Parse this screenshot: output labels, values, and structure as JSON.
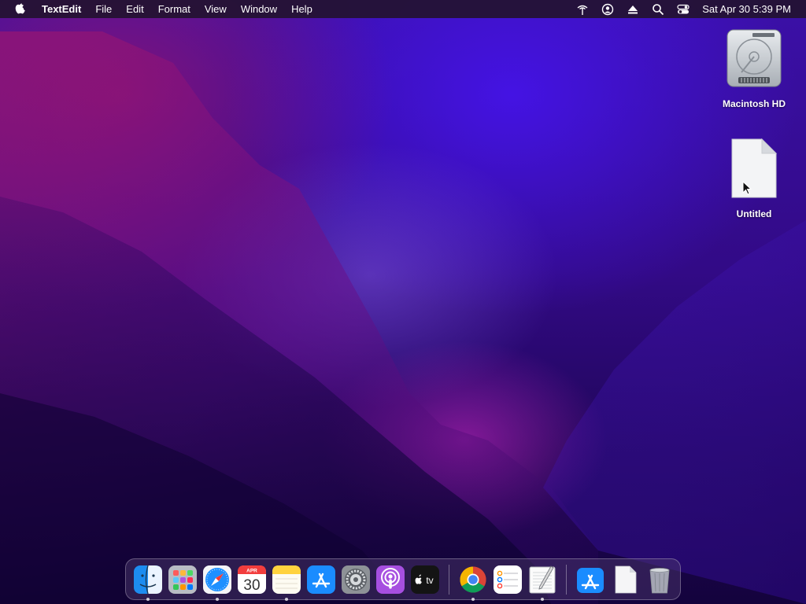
{
  "menubar": {
    "app_name": "TextEdit",
    "menus": [
      "File",
      "Edit",
      "Format",
      "View",
      "Window",
      "Help"
    ],
    "clock": "Sat Apr 30  5:39 PM",
    "status_icons": [
      "airdrop-icon",
      "user-account-icon",
      "eject-icon",
      "search-icon",
      "control-center-icon"
    ]
  },
  "desktop": {
    "icons": [
      {
        "label": "Macintosh HD",
        "icon": "hard-drive-icon"
      },
      {
        "label": "Untitled",
        "icon": "document-icon"
      }
    ]
  },
  "dock": {
    "calendar": {
      "month": "APR",
      "day": "30"
    },
    "tv_label": "tv",
    "apps": [
      {
        "name": "finder",
        "running": true
      },
      {
        "name": "launchpad",
        "running": false
      },
      {
        "name": "safari",
        "running": true
      },
      {
        "name": "calendar",
        "running": false
      },
      {
        "name": "notes",
        "running": true
      },
      {
        "name": "app-store",
        "running": false
      },
      {
        "name": "system-preferences",
        "running": false
      },
      {
        "name": "podcasts",
        "running": false
      },
      {
        "name": "apple-tv",
        "running": false
      },
      {
        "name": "chrome",
        "running": true
      },
      {
        "name": "reminders",
        "running": false
      },
      {
        "name": "textedit",
        "running": true
      },
      {
        "name": "downloads-stack",
        "running": false
      },
      {
        "name": "document-stack",
        "running": false
      },
      {
        "name": "trash",
        "running": false
      }
    ]
  },
  "colors": {
    "menubar_bg": "#231230",
    "wallpaper_top": "#3b10a8",
    "wallpaper_bottom": "#14033d",
    "accent_magenta": "#d228c8"
  }
}
